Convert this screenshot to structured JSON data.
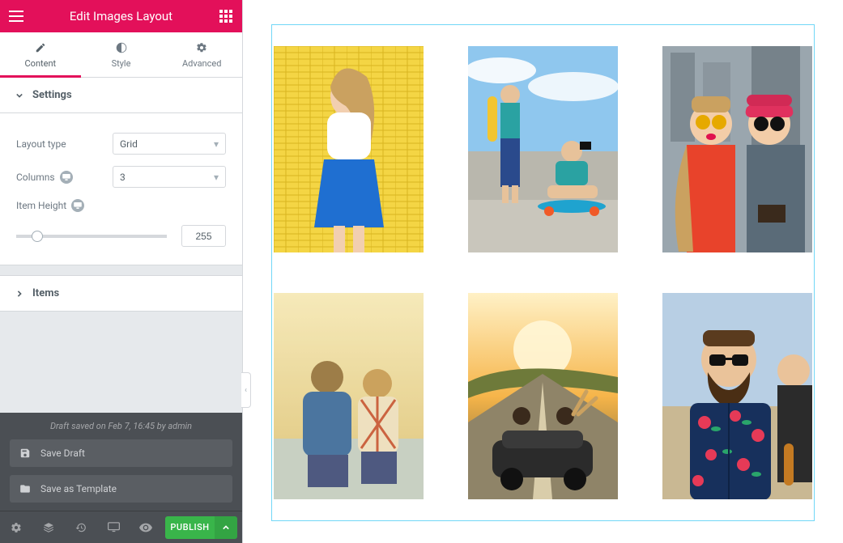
{
  "header": {
    "title": "Edit Images Layout"
  },
  "tabs": {
    "content": "Content",
    "style": "Style",
    "advanced": "Advanced"
  },
  "sections": {
    "settings": "Settings",
    "items": "Items"
  },
  "settings": {
    "layout_type_label": "Layout type",
    "layout_type_value": "Grid",
    "columns_label": "Columns",
    "columns_value": "3",
    "item_height_label": "Item Height",
    "item_height_value": "255",
    "slider_min": 0,
    "slider_max": 1000,
    "slider_percent": 14
  },
  "footer": {
    "draft_status": "Draft saved on Feb 7, 16:45 by admin",
    "save_draft": "Save Draft",
    "save_template": "Save as Template",
    "publish": "PUBLISH"
  },
  "grid": {
    "columns": 3,
    "item_height": 255,
    "count": 6
  }
}
